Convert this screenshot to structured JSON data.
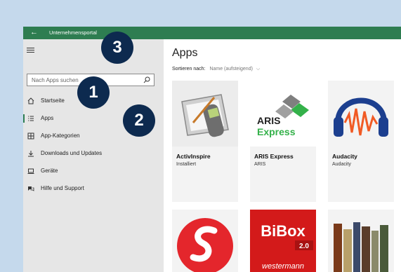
{
  "colors": {
    "accent": "#2e7d51",
    "badge": "#0d2a4f",
    "sidebar": "#e6e6e6"
  },
  "titlebar": {
    "back_icon": "back-arrow-icon",
    "title": "Unternehmensportal"
  },
  "sidebar": {
    "search_placeholder": "Nach Apps suchen",
    "items": [
      {
        "label": "Startseite",
        "icon": "home-icon"
      },
      {
        "label": "Apps",
        "icon": "list-icon",
        "selected": true
      },
      {
        "label": "App-Kategorien",
        "icon": "grid-icon"
      },
      {
        "label": "Downloads und Updates",
        "icon": "download-icon"
      },
      {
        "label": "Geräte",
        "icon": "device-icon"
      },
      {
        "label": "Hilfe und Support",
        "icon": "help-icon"
      }
    ]
  },
  "callouts": [
    "1",
    "2",
    "3"
  ],
  "main": {
    "title": "Apps",
    "sort_label": "Sortieren nach:",
    "sort_value": "Name (aufsteigend)",
    "tiles": [
      {
        "name": "ActivInspire",
        "subtitle": "Installiert"
      },
      {
        "name": "ARIS Express",
        "subtitle": "ARIS",
        "logo_text": "ARIS",
        "logo_sub": "Express"
      },
      {
        "name": "Audacity",
        "subtitle": "Audacity"
      },
      {
        "name": "",
        "subtitle": ""
      },
      {
        "name": "",
        "subtitle": "",
        "logo_text": "BiBox",
        "logo_version": "2.0",
        "logo_sub": "westermann"
      },
      {
        "name": "",
        "subtitle": ""
      }
    ]
  }
}
